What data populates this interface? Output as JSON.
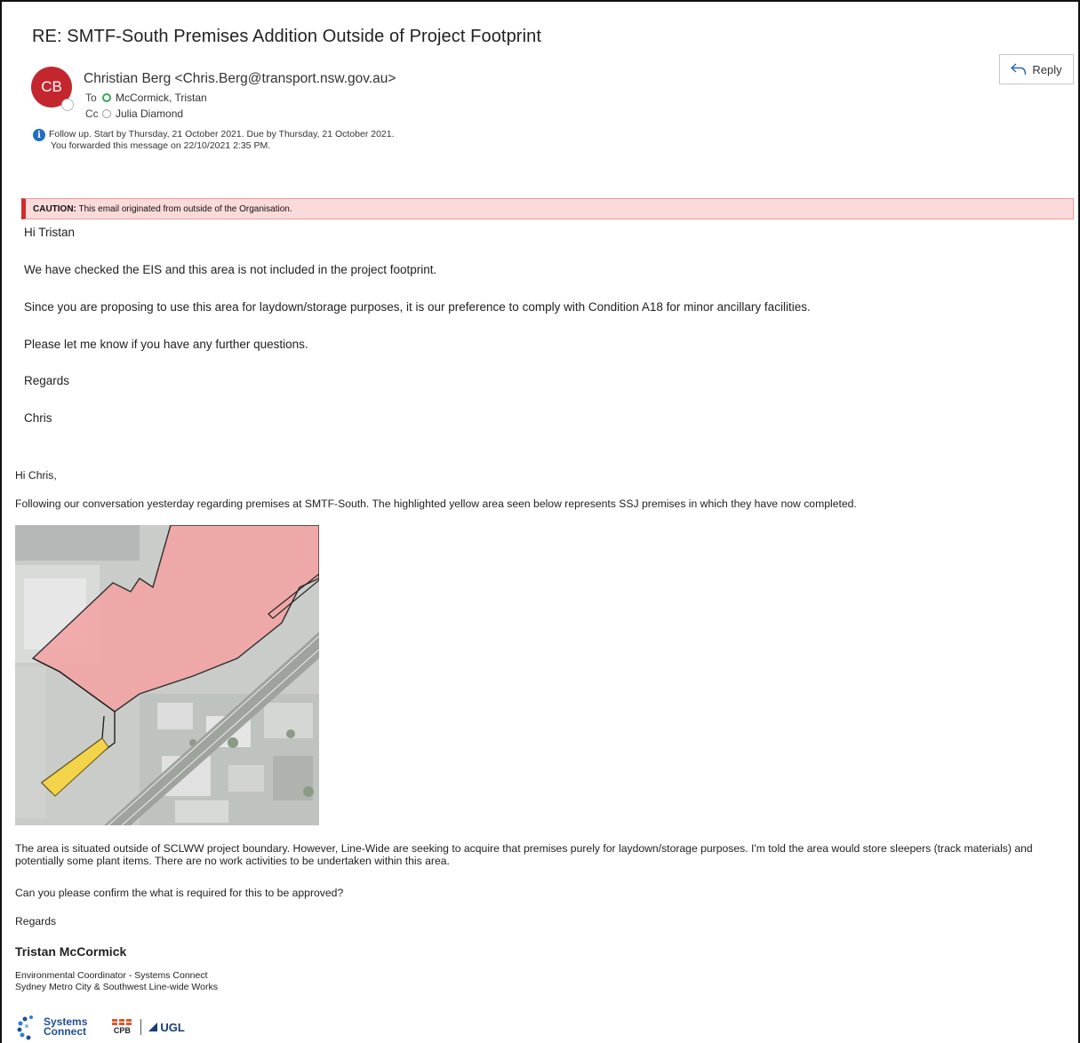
{
  "email": {
    "subject": "RE: SMTF-South Premises Addition Outside of Project Footprint",
    "avatar_initials": "CB",
    "sender": "Christian Berg <Chris.Berg@transport.nsw.gov.au>",
    "to_label": "To",
    "to_name": "McCormick, Tristan",
    "cc_label": "Cc",
    "cc_name": "Julia Diamond",
    "info_line1": "Follow up.  Start by Thursday, 21 October 2021.  Due by Thursday, 21 October 2021.",
    "info_line2": "You forwarded this message on 22/10/2021 2:35 PM.",
    "reply_label": "Reply"
  },
  "caution": {
    "label": "CAUTION:",
    "text": " This email originated from outside of the Organisation."
  },
  "reply_body": {
    "greeting": "Hi Tristan",
    "p1": "We have checked the EIS and this area is not included in the project footprint.",
    "p2": "Since you are proposing to use this area for laydown/storage purposes, it is our preference to comply with Condition A18 for minor ancillary facilities.",
    "p3": "Please let me know if you have any further questions.",
    "regards": "Regards",
    "signoff": "Chris"
  },
  "original_body": {
    "greeting": "Hi Chris,",
    "p1": "Following our conversation yesterday regarding premises at SMTF-South. The highlighted yellow area seen below represents SSJ premises in which they have now completed.",
    "p2": "The area is situated outside of SCLWW project boundary. However, Line-Wide are seeking to acquire that premises purely for laydown/storage purposes. I'm told the area would store sleepers (track materials) and potentially some plant items. There are no work activities to be undertaken within this area.",
    "p3": "Can you please confirm the what is required for this to be approved?",
    "regards": "Regards",
    "sig_name": "Tristan McCormick",
    "sig_title1": "Environmental Coordinator - Systems Connect",
    "sig_title2": "Sydney Metro City & Southwest Line-wide Works"
  },
  "logos": {
    "systems_connect_line1": "Systems",
    "systems_connect_line2": "Connect",
    "cpb": "CPB",
    "ugl": "UGL"
  },
  "colors": {
    "avatar": "#c4262e",
    "caution_bg": "#fbdada",
    "caution_bar": "#d12c2c",
    "map_red_area": "#f2a6a6",
    "map_yellow_area": "#f3d34a"
  }
}
